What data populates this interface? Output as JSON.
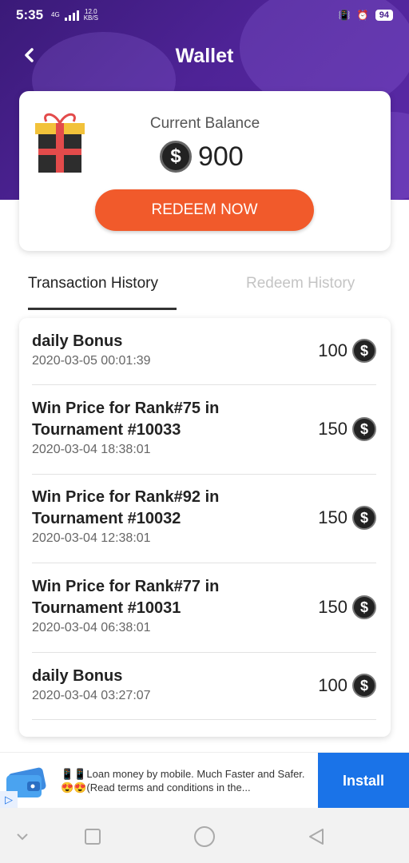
{
  "status_bar": {
    "time": "5:35",
    "network": "4G",
    "speed_value": "12.0",
    "speed_unit": "KB/S",
    "battery": "94"
  },
  "header": {
    "title": "Wallet"
  },
  "balance": {
    "label": "Current Balance",
    "value": "900",
    "coin_symbol": "$",
    "redeem_label": "REDEEM NOW"
  },
  "tabs": [
    {
      "label": "Transaction History",
      "active": true
    },
    {
      "label": "Redeem History",
      "active": false
    }
  ],
  "transactions": [
    {
      "title_line1": "daily Bonus",
      "title_line2": "",
      "date": "2020-03-05 00:01:39",
      "amount": "100"
    },
    {
      "title_line1": "Win Price for Rank#75 in",
      "title_line2": "Tournament #10033",
      "date": "2020-03-04 18:38:01",
      "amount": "150"
    },
    {
      "title_line1": "Win Price for Rank#92 in",
      "title_line2": "Tournament #10032",
      "date": "2020-03-04 12:38:01",
      "amount": "150"
    },
    {
      "title_line1": "Win Price for Rank#77 in",
      "title_line2": "Tournament #10031",
      "date": "2020-03-04 06:38:01",
      "amount": "150"
    },
    {
      "title_line1": "daily Bonus",
      "title_line2": "",
      "date": "2020-03-04 03:27:07",
      "amount": "100"
    }
  ],
  "ad": {
    "text": "📱📱Loan money by mobile. Much Faster and Safer.😍😍(Read terms and conditions in the...",
    "install_label": "Install"
  },
  "colors": {
    "header_purple": "#4e2396",
    "redeem_orange": "#f15a2b",
    "install_blue": "#1a73e8"
  },
  "icons": {
    "back": "chevron-left-icon",
    "gift": "gift-box-icon",
    "coin": "dollar-coin-icon"
  }
}
